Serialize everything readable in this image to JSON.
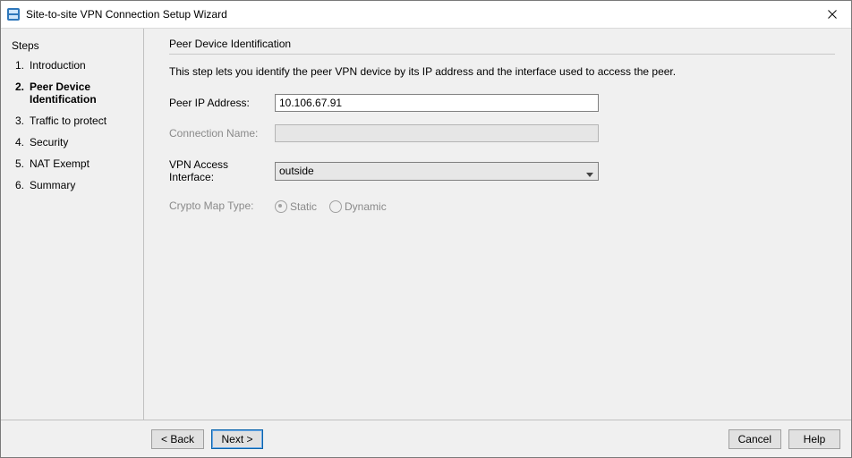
{
  "window": {
    "title": "Site-to-site VPN Connection Setup Wizard"
  },
  "sidebar": {
    "heading": "Steps",
    "items": [
      {
        "num": "1.",
        "label": "Introduction"
      },
      {
        "num": "2.",
        "label": "Peer Device Identification"
      },
      {
        "num": "3.",
        "label": "Traffic to protect"
      },
      {
        "num": "4.",
        "label": "Security"
      },
      {
        "num": "5.",
        "label": "NAT Exempt"
      },
      {
        "num": "6.",
        "label": "Summary"
      }
    ],
    "current_index": 1
  },
  "main": {
    "section_title": "Peer Device Identification",
    "description": "This step lets you identify the peer VPN device by its IP address and the interface used to access the peer.",
    "peer_ip_label": "Peer IP Address:",
    "peer_ip_value": "10.106.67.91",
    "conn_name_label": "Connection Name:",
    "conn_name_value": "",
    "vpn_iface_label": "VPN Access Interface:",
    "vpn_iface_value": "outside",
    "crypto_label": "Crypto Map Type:",
    "crypto_options": [
      {
        "label": "Static",
        "checked": true
      },
      {
        "label": "Dynamic",
        "checked": false
      }
    ]
  },
  "footer": {
    "back": "< Back",
    "next": "Next >",
    "cancel": "Cancel",
    "help": "Help"
  }
}
